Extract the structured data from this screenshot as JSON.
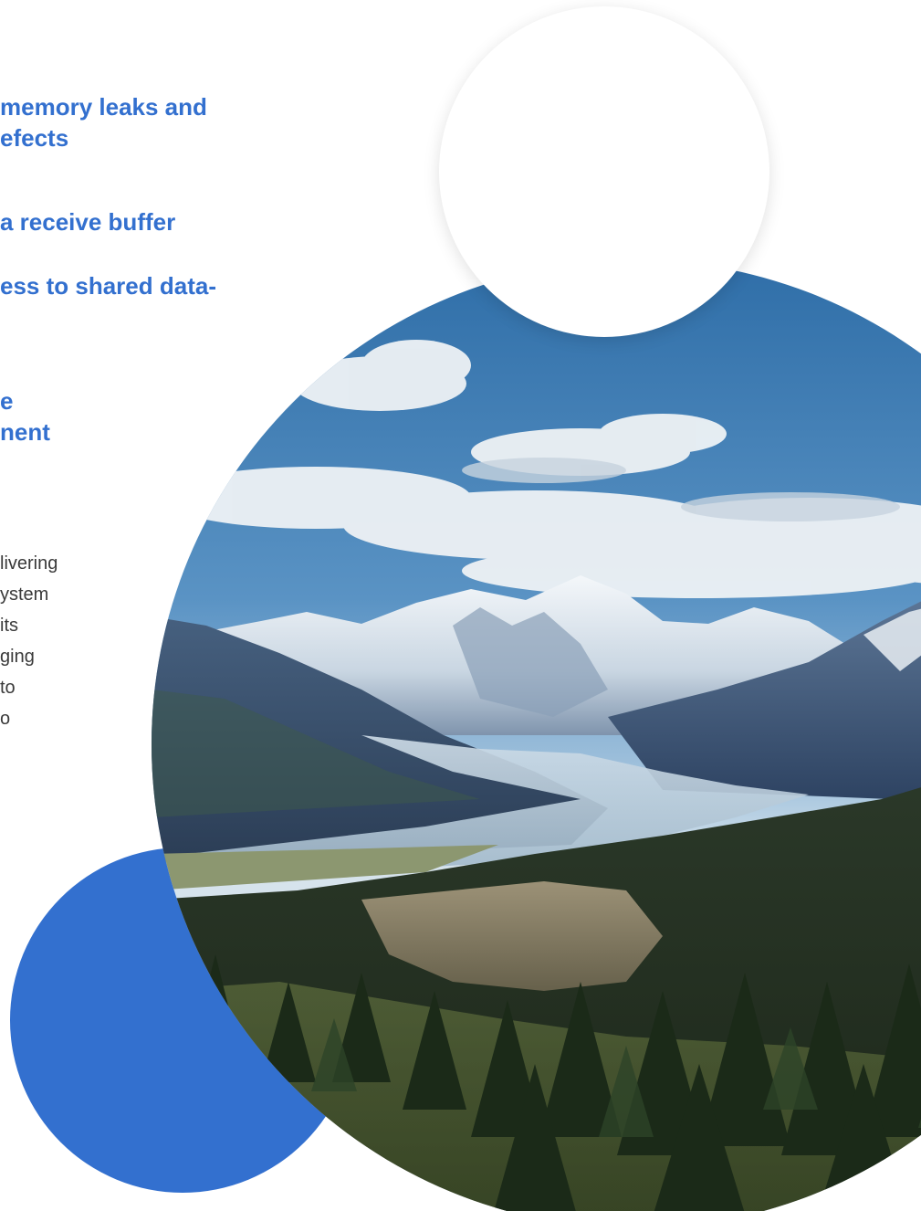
{
  "features": {
    "items": [
      {
        "lines": [
          " memory leaks and",
          "efects"
        ]
      },
      {
        "lines": [
          "a receive buffer"
        ]
      },
      {
        "lines": [
          "ess to shared data-"
        ]
      },
      {
        "lines": [
          "e",
          "nent"
        ]
      }
    ]
  },
  "description": {
    "lines": [
      "livering",
      "ystem",
      " its",
      "ging",
      " to",
      "o"
    ]
  },
  "colors": {
    "accent": "#3370cf",
    "body_text": "#3a3a3a",
    "background": "#ffffff"
  },
  "image": {
    "subject": "mountain-valley-landscape"
  }
}
